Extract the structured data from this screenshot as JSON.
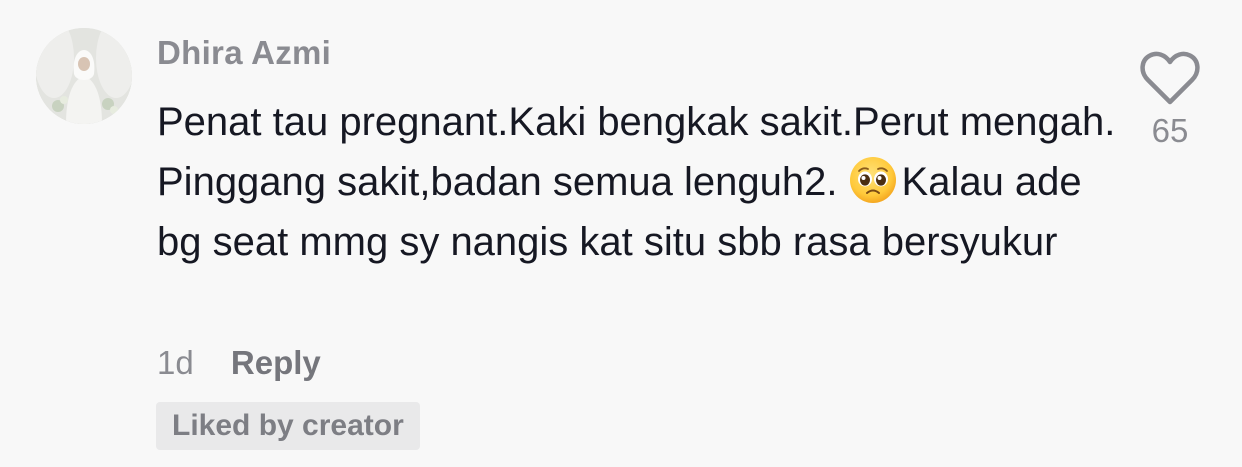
{
  "comment": {
    "username": "Dhira Azmi",
    "text_before_emoji": "Penat tau pregnant.Kaki bengkak sakit.Perut mengah. Pinggang sakit,badan semua lenguh2.",
    "emoji": "pleading-face",
    "text_after_emoji": "Kalau ade bg seat mmg sy nangis kat situ sbb rasa bersyukur",
    "date": "1d",
    "reply_label": "Reply",
    "liked_badge": "Liked by creator",
    "like_count": "65"
  },
  "colors": {
    "background": "#f8f8f8",
    "text": "#161823",
    "muted": "#8a8b91",
    "badge_bg": "#e9e9ea"
  },
  "icons": {
    "like": "heart-outline-icon"
  }
}
